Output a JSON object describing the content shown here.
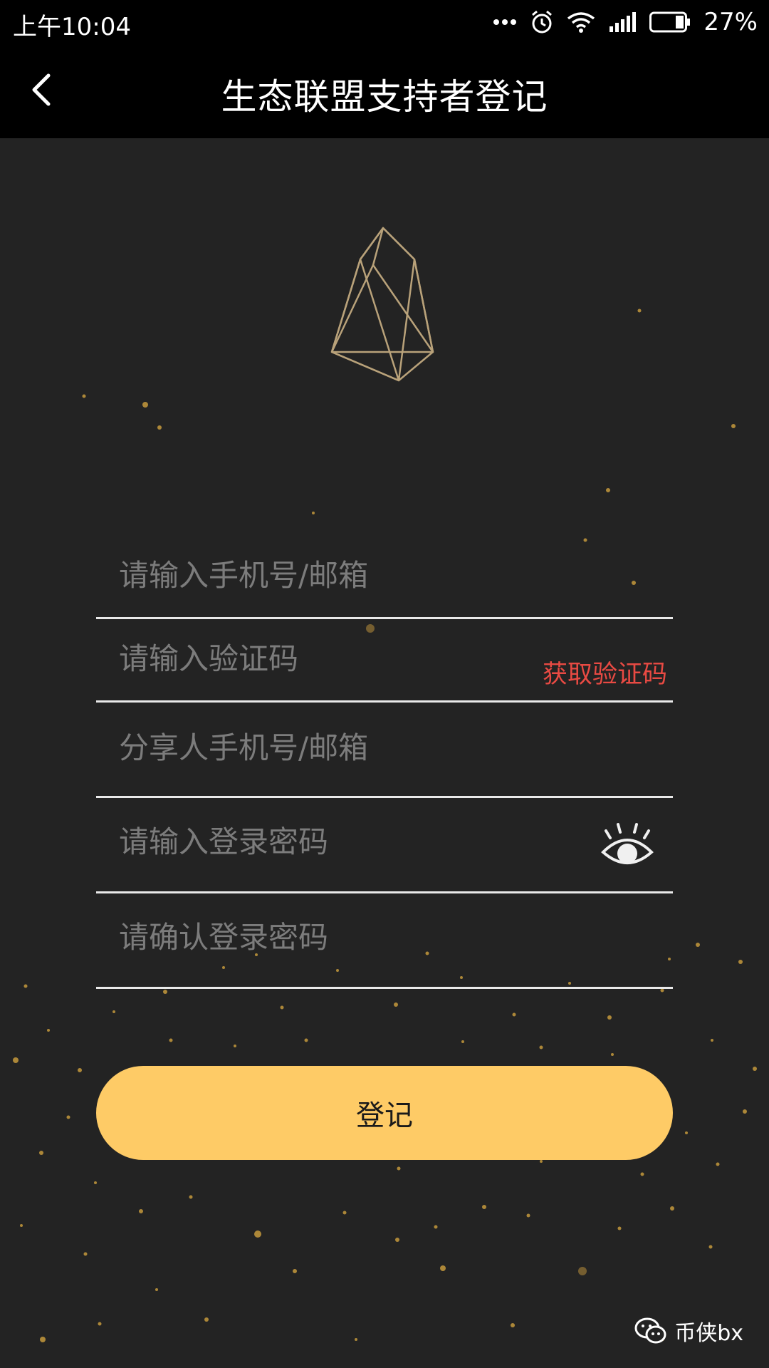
{
  "status_bar": {
    "time": "上午10:04",
    "battery": "27%"
  },
  "header": {
    "title": "生态联盟支持者登记"
  },
  "form": {
    "phone_placeholder": "请输入手机号/邮箱",
    "code_placeholder": "请输入验证码",
    "get_code_label": "获取验证码",
    "referrer_placeholder": "分享人手机号/邮箱",
    "password_placeholder": "请输入登录密码",
    "confirm_placeholder": "请确认登录密码"
  },
  "submit_label": "登记",
  "watermark": {
    "text": "币侠bx"
  },
  "colors": {
    "background": "#232323",
    "button": "#fecb66",
    "link": "#e84a43",
    "logo_stroke": "#b9a27a"
  }
}
